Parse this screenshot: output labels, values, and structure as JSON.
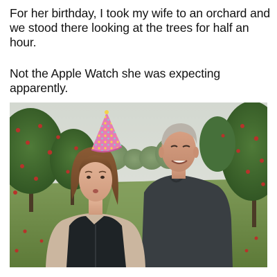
{
  "post": {
    "caption_line_1": "For her birthday, I took my wife to an orchard and we stood there looking at the trees for half an hour.",
    "caption_line_2": "Not the Apple Watch she was expecting apparently."
  },
  "photo": {
    "subject": "orchard-couple-photo",
    "colors": {
      "sky": "#d9ddd6",
      "grass": "#6f8f4a",
      "foliage": "#3f6a2e",
      "apple": "#b8322a",
      "party_hat": "#e77fb7",
      "vest": "#1e2326",
      "sweater": "#3a3f43"
    }
  }
}
